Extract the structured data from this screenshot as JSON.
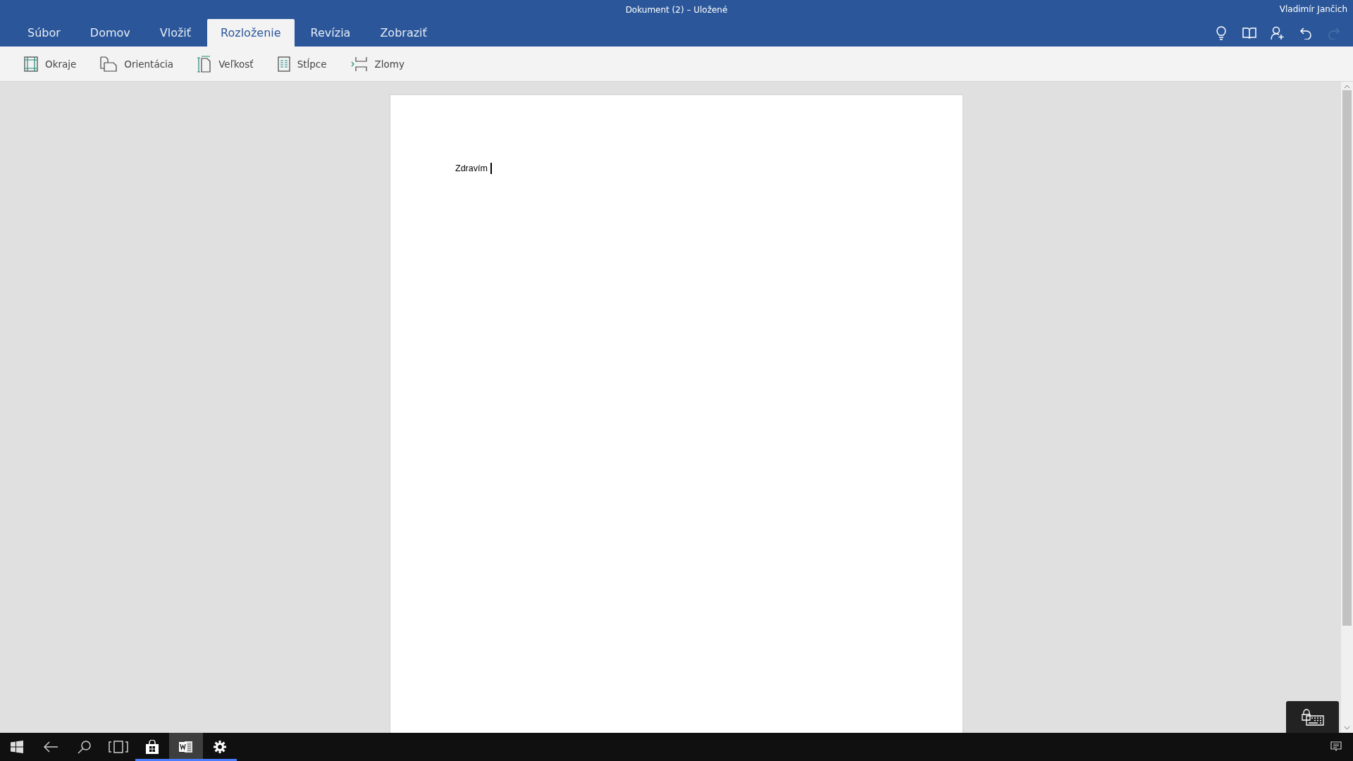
{
  "window": {
    "title": "Dokument (2) – Uložené",
    "user": "Vladimír Jančich"
  },
  "tabs": [
    {
      "label": "Súbor",
      "selected": false
    },
    {
      "label": "Domov",
      "selected": false
    },
    {
      "label": "Vložiť",
      "selected": false
    },
    {
      "label": "Rozloženie",
      "selected": true
    },
    {
      "label": "Revízia",
      "selected": false
    },
    {
      "label": "Zobraziť",
      "selected": false
    }
  ],
  "quick_actions": [
    {
      "kind": "lightbulb",
      "disabled": false
    },
    {
      "kind": "reading",
      "disabled": false
    },
    {
      "kind": "share",
      "disabled": false
    },
    {
      "kind": "undo",
      "disabled": false
    },
    {
      "kind": "redo",
      "disabled": true
    }
  ],
  "ribbon": [
    {
      "kind": "margins",
      "label": "Okraje"
    },
    {
      "kind": "orientation",
      "label": "Orientácia"
    },
    {
      "kind": "size",
      "label": "Veľkosť"
    },
    {
      "kind": "columns",
      "label": "Stĺpce"
    },
    {
      "kind": "breaks",
      "label": "Zlomy"
    }
  ],
  "document": {
    "text": "Zdravím"
  },
  "taskbar": [
    {
      "kind": "start",
      "running": false,
      "selected": false
    },
    {
      "kind": "back",
      "running": false,
      "selected": false
    },
    {
      "kind": "search",
      "running": false,
      "selected": false
    },
    {
      "kind": "taskview",
      "running": false,
      "selected": false
    },
    {
      "kind": "store",
      "running": true,
      "selected": false
    },
    {
      "kind": "word",
      "running": true,
      "selected": true
    },
    {
      "kind": "settings",
      "running": true,
      "selected": false
    },
    {
      "kind": "notifications",
      "running": false,
      "selected": false
    }
  ]
}
